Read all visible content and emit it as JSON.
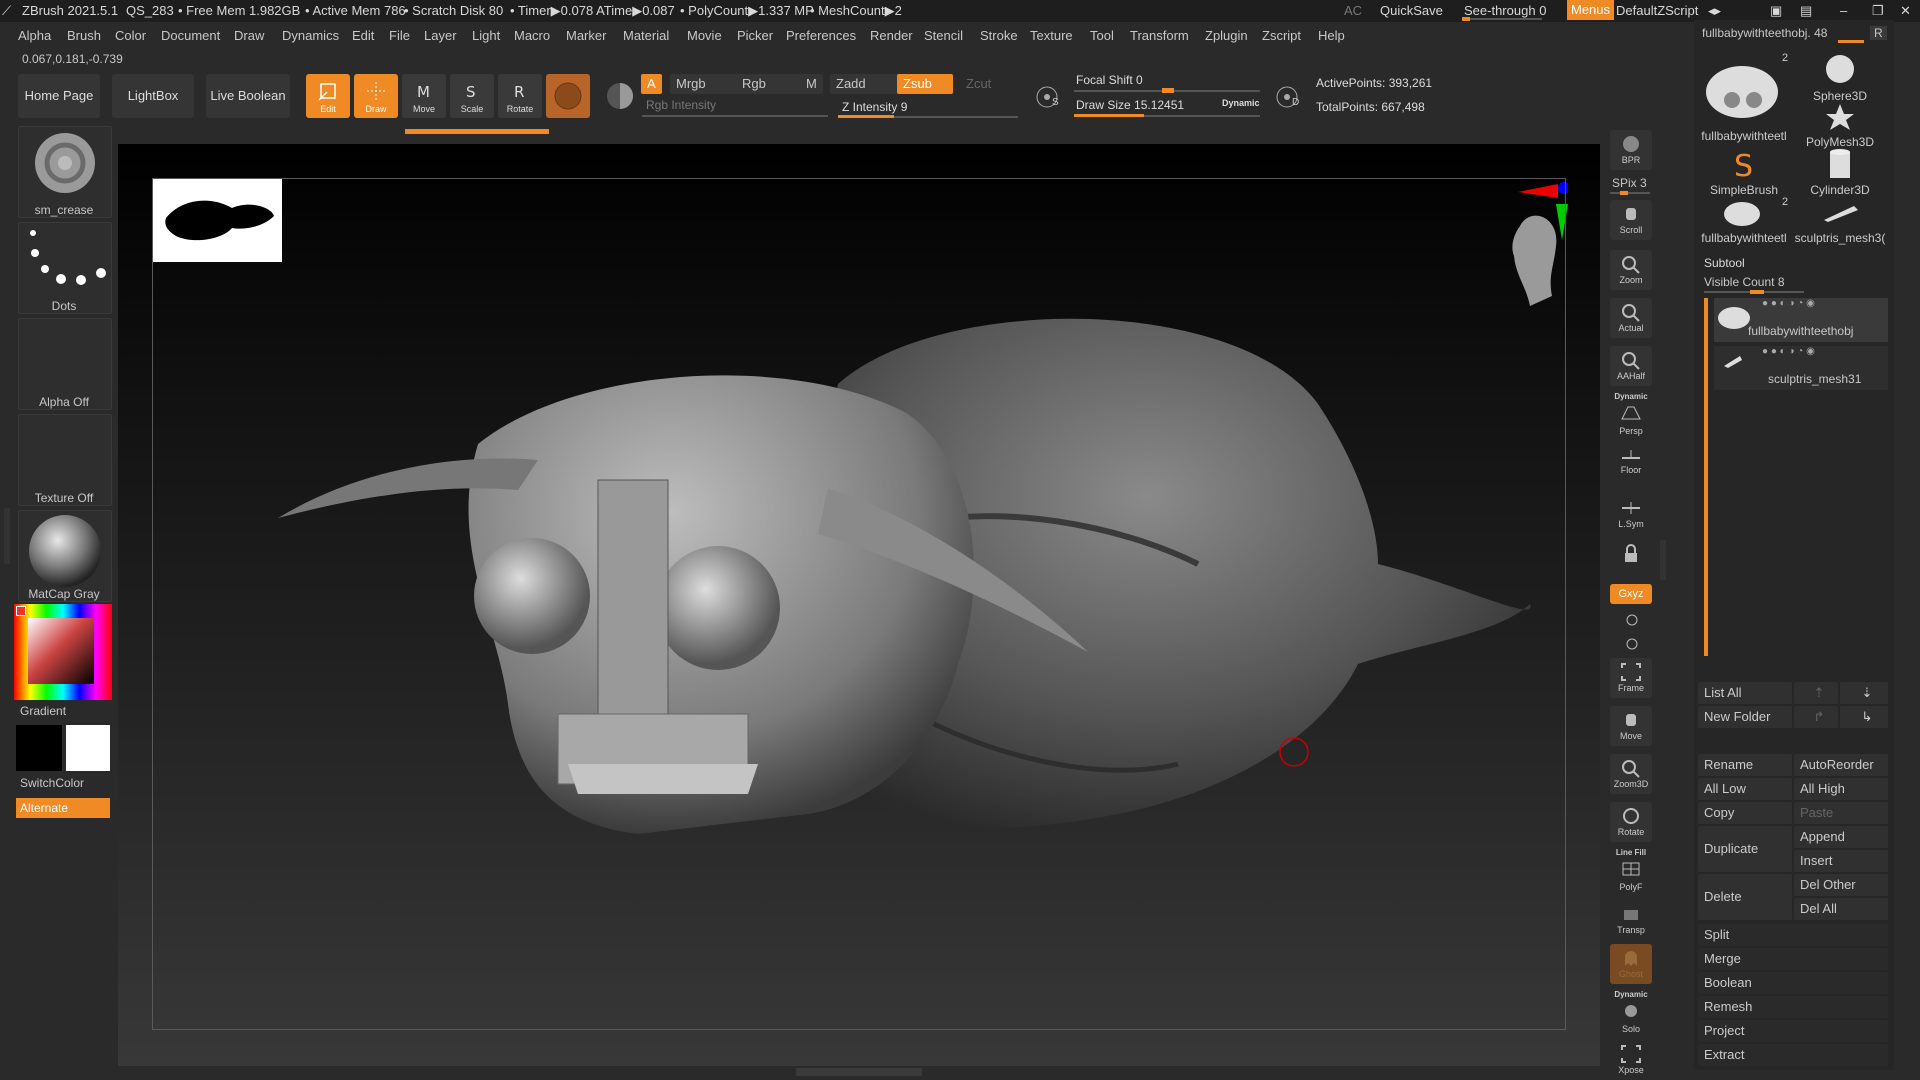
{
  "titlebar": {
    "app": "ZBrush 2021.5.1",
    "doc": "QS_283",
    "free_mem": "• Free Mem 1.982GB",
    "active_mem": "• Active Mem 786",
    "scratch": "• Scratch Disk 80",
    "timer": "• Timer▶0.078 ATime▶0.087",
    "polycount": "• PolyCount▶1.337 MP",
    "meshcount": "• MeshCount▶2",
    "ac": "AC",
    "quicksave": "QuickSave",
    "seethrough": "See-through",
    "seethrough_value": "0",
    "menus": "Menus",
    "default_zscript": "DefaultZScript"
  },
  "menubar": [
    "Alpha",
    "Brush",
    "Color",
    "Document",
    "Draw",
    "Dynamics",
    "Edit",
    "File",
    "Layer",
    "Light",
    "Macro",
    "Marker",
    "Material",
    "Movie",
    "Picker",
    "Preferences",
    "Render",
    "Stencil",
    "Stroke",
    "Texture",
    "Tool",
    "Transform",
    "Zplugin",
    "Zscript",
    "Help"
  ],
  "coords": "0.067,0.181,-0.739",
  "shelf": {
    "home": "Home Page",
    "lightbox": "LightBox",
    "live_boolean": "Live Boolean",
    "edit": "Edit",
    "draw": "Draw",
    "move": "Move",
    "scale": "Scale",
    "rotate": "Rotate",
    "a": "A",
    "mrgb": "Mrgb",
    "rgb": "Rgb",
    "m": "M",
    "rgb_intensity": "Rgb Intensity",
    "zadd": "Zadd",
    "zsub": "Zsub",
    "zcut": "Zcut",
    "z_intensity": "Z Intensity 9",
    "focal_shift": "Focal Shift 0",
    "draw_size": "Draw Size 15.12451",
    "dynamic": "Dynamic",
    "active_points": "ActivePoints: 393,261",
    "total_points": "TotalPoints: 667,498",
    "s_label": "S",
    "d_label": "D"
  },
  "left": {
    "brush": "sm_crease",
    "stroke": "Dots",
    "alpha": "Alpha Off",
    "texture": "Texture Off",
    "material": "MatCap Gray",
    "gradient": "Gradient",
    "switchcolor": "SwitchColor",
    "alternate": "Alternate"
  },
  "right_shelf": {
    "bpr": "BPR",
    "spix": "SPix 3",
    "scroll": "Scroll",
    "zoom": "Zoom",
    "actual": "Actual",
    "aahalf": "AAHalf",
    "persp_top": "Dynamic",
    "persp": "Persp",
    "floor": "Floor",
    "lsym": "L.Sym",
    "xyz": "Gxyz",
    "frame": "Frame",
    "move": "Move",
    "zoom3d": "Zoom3D",
    "rotate": "Rotate",
    "linefill_top": "Line Fill",
    "linefill": "PolyF",
    "transp": "Transp",
    "ghost": "Ghost",
    "solo_top": "Dynamic",
    "solo": "Solo",
    "xpose": "Xpose"
  },
  "tool_panel": {
    "current_tool": "fullbabywithteethobj. 48",
    "r": "R",
    "thumbs": [
      {
        "name": "fullbabywithteetl",
        "badge": "2"
      },
      {
        "name": "Sphere3D",
        "badge": ""
      },
      {
        "name": "PolyMesh3D",
        "badge": ""
      },
      {
        "name": "SimpleBrush",
        "badge": ""
      },
      {
        "name": "Cylinder3D",
        "badge": ""
      },
      {
        "name": "fullbabywithteetl",
        "badge": "2"
      },
      {
        "name": "sculptris_mesh3(",
        "badge": ""
      }
    ],
    "subtool_title": "Subtool",
    "visible_count": "Visible Count 8",
    "subtools": [
      "fullbabywithteethobj",
      "sculptris_mesh31"
    ],
    "list_all": "List All",
    "new_folder": "New Folder",
    "rename": "Rename",
    "autoreorder": "AutoReorder",
    "all_low": "All Low",
    "all_high": "All High",
    "copy": "Copy",
    "paste": "Paste",
    "duplicate": "Duplicate",
    "append": "Append",
    "insert": "Insert",
    "delete": "Delete",
    "del_other": "Del Other",
    "del_all": "Del All",
    "split": "Split",
    "merge": "Merge",
    "boolean": "Boolean",
    "remesh": "Remesh",
    "project": "Project",
    "extract": "Extract"
  },
  "colors": {
    "accent": "#f08a24",
    "bg": "#2a2a2a",
    "panel": "#262626"
  }
}
